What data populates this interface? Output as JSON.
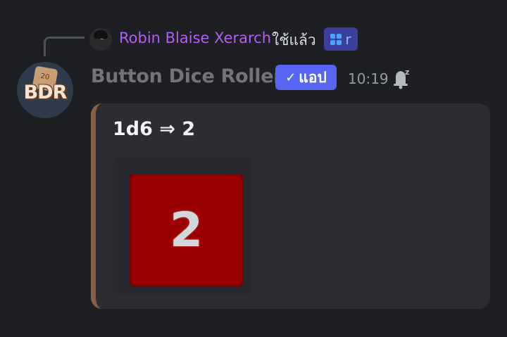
{
  "reply": {
    "user_name": "Robin Blaise Xerarch",
    "action_text": "ใช้แล้ว",
    "command_label": "r"
  },
  "message": {
    "author": "Button Dice Roller",
    "avatar_text": "BDR",
    "app_badge": "แอป",
    "timestamp": "10:19"
  },
  "embed": {
    "title": "1d6 ⇒ 2",
    "accent_color": "#8a5f42",
    "die_result": "2",
    "die_color": "#9b0000"
  }
}
